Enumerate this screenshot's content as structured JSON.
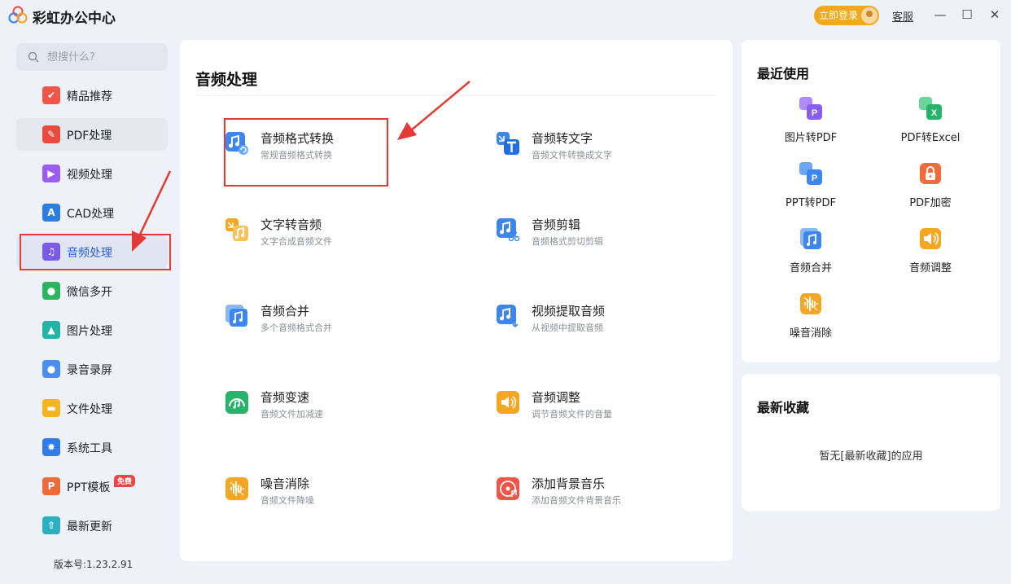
{
  "window": {
    "title": "彩虹办公中心",
    "login_label": "立即登录",
    "service_label": "客服",
    "minimize_glyph": "—",
    "maximize_glyph": "☐",
    "close_glyph": "✕"
  },
  "sidebar": {
    "search_placeholder": "想搜什么?",
    "items": [
      {
        "label": "精品推荐",
        "icon": "thumbs-up-icon",
        "color": "#f0554a"
      },
      {
        "label": "PDF处理",
        "icon": "pdf-icon",
        "color": "#e84a3f"
      },
      {
        "label": "视频处理",
        "icon": "video-play-icon",
        "color": "#9b5cf0"
      },
      {
        "label": "CAD处理",
        "icon": "cad-icon",
        "color": "#2b7de0"
      },
      {
        "label": "音频处理",
        "icon": "music-note-icon",
        "color": "#7a5ae8"
      },
      {
        "label": "微信多开",
        "icon": "wechat-icon",
        "color": "#2bb55e"
      },
      {
        "label": "图片处理",
        "icon": "image-icon",
        "color": "#22b5a4"
      },
      {
        "label": "录音录屏",
        "icon": "microphone-icon",
        "color": "#4a8ef0"
      },
      {
        "label": "文件处理",
        "icon": "folder-icon",
        "color": "#f2b51f"
      },
      {
        "label": "系统工具",
        "icon": "gear-icon",
        "color": "#2f7be8"
      },
      {
        "label": "PPT模板",
        "icon": "ppt-icon",
        "color": "#ef6a3a",
        "badge": "免费"
      },
      {
        "label": "最新更新",
        "icon": "upload-icon",
        "color": "#2bb0c2"
      }
    ],
    "version": "版本号:1.23.2.91"
  },
  "main": {
    "title": "音频处理",
    "tools": [
      {
        "name": "音频格式转换",
        "desc": "常规音频格式转换",
        "icon": "audio-convert-icon",
        "color": "#3d86f0"
      },
      {
        "name": "音频转文字",
        "desc": "音频文件转换成文字",
        "icon": "audio-to-text-icon",
        "color": "#3d86f0"
      },
      {
        "name": "文字转音频",
        "desc": "文字合成音频文件",
        "icon": "text-to-audio-icon",
        "color": "#f5a623"
      },
      {
        "name": "音频剪辑",
        "desc": "音频格式剪切剪辑",
        "icon": "audio-cut-icon",
        "color": "#3d86f0"
      },
      {
        "name": "音频合并",
        "desc": "多个音频格式合并",
        "icon": "audio-merge-icon",
        "color": "#3d86f0"
      },
      {
        "name": "视频提取音频",
        "desc": "从视频中提取音频",
        "icon": "video-extract-audio-icon",
        "color": "#3d86f0"
      },
      {
        "name": "音频变速",
        "desc": "音频文件加减速",
        "icon": "audio-speed-icon",
        "color": "#27b36a"
      },
      {
        "name": "音频调整",
        "desc": "调节音频文件的音量",
        "icon": "audio-volume-icon",
        "color": "#f5a623"
      },
      {
        "name": "噪音消除",
        "desc": "音频文件降噪",
        "icon": "noise-reduction-icon",
        "color": "#f5a623"
      },
      {
        "name": "添加背景音乐",
        "desc": "添加音频文件背景音乐",
        "icon": "background-music-icon",
        "color": "#f0554a"
      }
    ]
  },
  "recent": {
    "title": "最近使用",
    "items": [
      {
        "label": "图片转PDF",
        "icon": "image-to-pdf-icon",
        "color": "#8a5cf0"
      },
      {
        "label": "PDF转Excel",
        "icon": "pdf-to-excel-icon",
        "color": "#27b36a"
      },
      {
        "label": "PPT转PDF",
        "icon": "ppt-to-pdf-icon",
        "color": "#3d86f0"
      },
      {
        "label": "PDF加密",
        "icon": "pdf-lock-icon",
        "color": "#f26b3a"
      },
      {
        "label": "音频合并",
        "icon": "audio-merge-icon",
        "color": "#3d86f0"
      },
      {
        "label": "音频调整",
        "icon": "audio-volume-icon",
        "color": "#f5a623"
      },
      {
        "label": "噪音消除",
        "icon": "noise-reduction-icon",
        "color": "#f5a623"
      }
    ]
  },
  "favorites": {
    "title": "最新收藏",
    "empty_text": "暂无[最新收藏]的应用"
  }
}
